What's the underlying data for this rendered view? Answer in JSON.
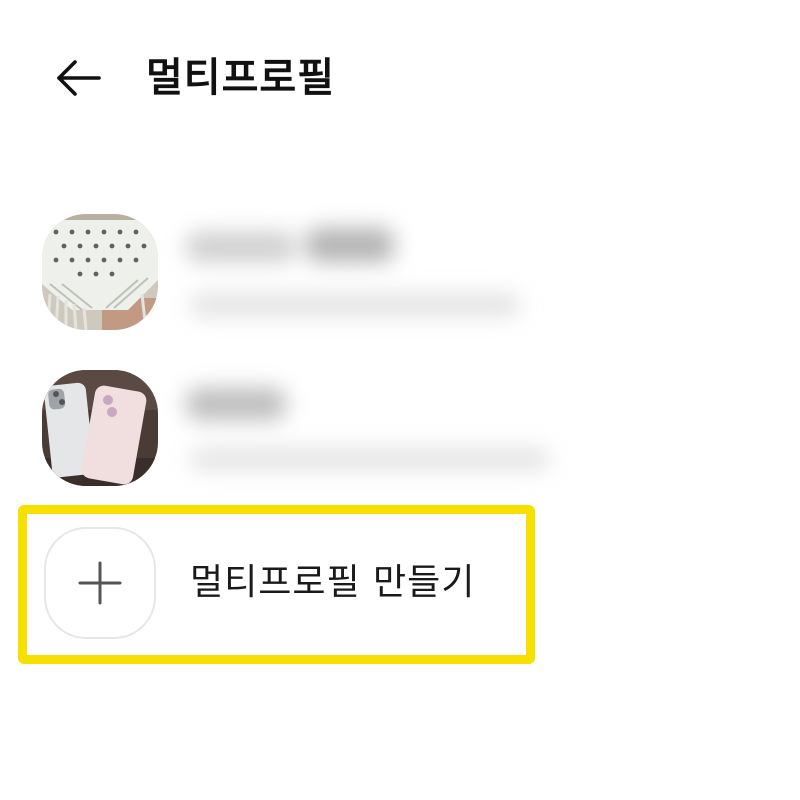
{
  "header": {
    "title": "멀티프로필",
    "back_icon": "arrow-left-icon"
  },
  "profiles": [
    {
      "avatar_icon": "macrame-photo",
      "name": "",
      "subtitle": ""
    },
    {
      "avatar_icon": "phone-cases-photo",
      "name": "",
      "subtitle": ""
    }
  ],
  "create": {
    "icon": "plus-icon",
    "label": "멀티프로필 만들기",
    "highlight_color": "#f6e000"
  },
  "colors": {
    "background": "#ffffff",
    "text": "#111111",
    "highlight": "#f6e000",
    "icon_border": "#e7e7e7"
  }
}
